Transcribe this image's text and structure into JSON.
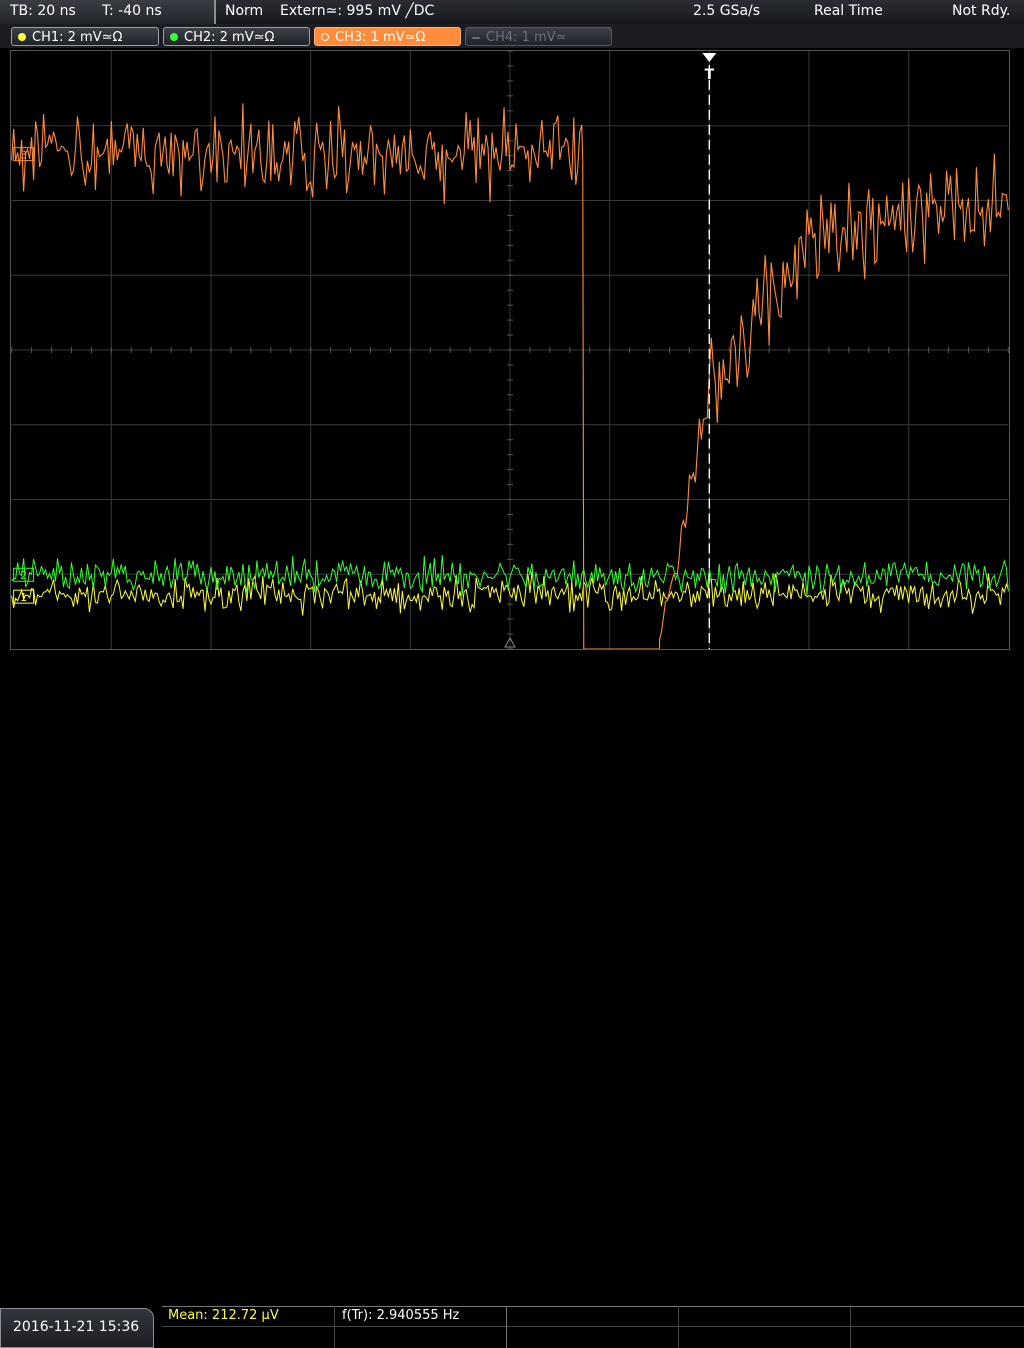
{
  "topbar": {
    "timebase": "TB: 20 ns",
    "trigger_pos": "T: -40 ns",
    "mode": "Norm",
    "trigger_source": "Extern≃: 995 mV ╱DC",
    "sample_rate": "2.5 GSa/s",
    "acq_mode": "Real Time",
    "status": "Not Rdy."
  },
  "channels": [
    {
      "label": "CH1: 2 mV≃Ω",
      "color": "#ffff33",
      "state": "on"
    },
    {
      "label": "CH2: 2 mV≃Ω",
      "color": "#33ff33",
      "state": "on"
    },
    {
      "label": "CH3: 1 mV≃Ω",
      "color": "#ff8c3a",
      "state": "active"
    },
    {
      "label": "CH4: 1 mV≃",
      "color": "#6b6f77",
      "state": "off"
    }
  ],
  "screen": {
    "trigger_marker": "T",
    "channel_markers": [
      "1",
      "2",
      "3"
    ]
  },
  "bottombar": {
    "datetime": "2016-11-21 15:36",
    "measurements": [
      {
        "label": "Mean: 212.72 µV",
        "color": "#ffff33"
      },
      {
        "label": "f(Tr): 2.940555 Hz",
        "color": "#ffffff"
      }
    ]
  },
  "colors": {
    "ch1": "#ffff33",
    "ch2": "#33ff33",
    "ch3": "#ff8c3a",
    "grid": "#3a3a3a",
    "trigger_line": "#ffffff"
  }
}
